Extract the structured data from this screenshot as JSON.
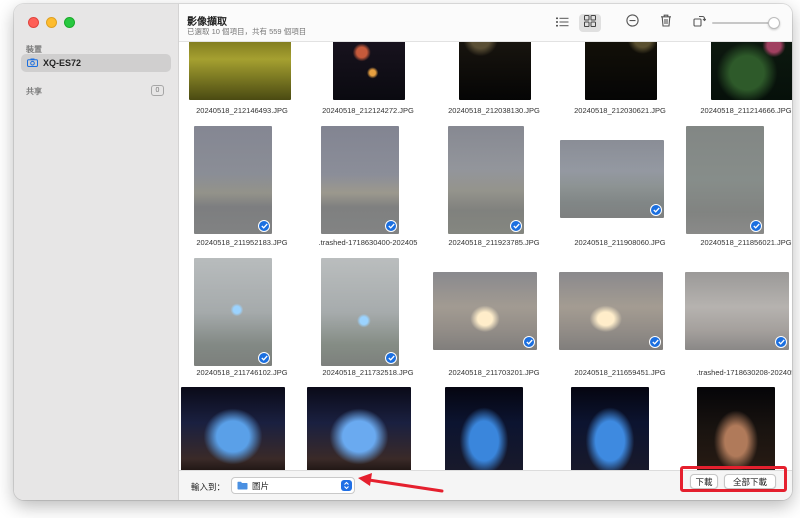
{
  "window": {
    "title": "影像擷取",
    "subtitle": "已選取 10 個項目，共有 559 個項目"
  },
  "sidebar": {
    "devices_label": "裝置",
    "device_name": "XQ-ES72",
    "shared_label": "共享",
    "shared_count": "0"
  },
  "toolbar": {
    "list_view": "list-view-icon",
    "grid_view": "grid-view-icon",
    "delete_icon": "minus-circle-icon",
    "trash_icon": "trash-icon",
    "rotate_icon": "rotate-icon",
    "thumbnail_size_level": 1.0
  },
  "photos": [
    {
      "name": "20240518_212146493.JPG",
      "selected": false
    },
    {
      "name": "20240518_212124272.JPG",
      "selected": false
    },
    {
      "name": "20240518_212038130.JPG",
      "selected": false
    },
    {
      "name": "20240518_212030621.JPG",
      "selected": false
    },
    {
      "name": "20240518_211214666.JPG",
      "selected": false
    },
    {
      "name": "20240518_211952183.JPG",
      "selected": true
    },
    {
      "name": ".trashed-1718630400-202405",
      "selected": true
    },
    {
      "name": "20240518_211923785.JPG",
      "selected": true
    },
    {
      "name": "20240518_211908060.JPG",
      "selected": true
    },
    {
      "name": "20240518_211856021.JPG",
      "selected": true
    },
    {
      "name": "20240518_211746102.JPG",
      "selected": true
    },
    {
      "name": "20240518_211732518.JPG",
      "selected": true
    },
    {
      "name": "20240518_211703201.JPG",
      "selected": true
    },
    {
      "name": "20240518_211659451.JPG",
      "selected": true
    },
    {
      "name": ".trashed-1718630208-202405",
      "selected": true
    },
    {
      "name": "",
      "selected": false
    },
    {
      "name": "",
      "selected": false
    },
    {
      "name": "",
      "selected": false
    },
    {
      "name": "",
      "selected": false
    },
    {
      "name": "",
      "selected": false
    }
  ],
  "bottom": {
    "import_label": "輸入到：",
    "destination": "圖片",
    "download_label": "下載",
    "download_all_label": "全部下載"
  },
  "colors": {
    "accent": "#1b6fe0",
    "highlight": "#e5202e"
  }
}
